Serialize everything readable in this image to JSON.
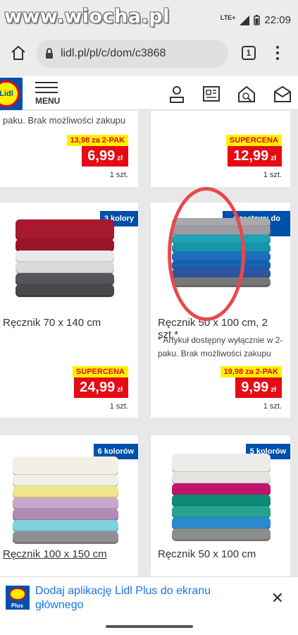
{
  "status": {
    "watermark": "www.wiocha.pl",
    "network": "LTE+",
    "time": "22:09"
  },
  "browser": {
    "url": "lidl.pl/pl/c/dom/c3868",
    "tab_count": "1"
  },
  "header": {
    "menu_label": "MENU"
  },
  "products": [
    {
      "note": "paku. Brak możliwości zakupu",
      "tag": "13,98 za 2-PAK",
      "price": "6,99",
      "currency": "zł",
      "qty": "1 szt."
    },
    {
      "tag": "SUPERCENA",
      "price": "12,99",
      "currency": "zł",
      "qty": "1 szt."
    },
    {
      "badge": "3 kolory",
      "title": "Ręcznik 70 x 140 cm",
      "tag": "SUPERCENA",
      "price": "24,99",
      "currency": "zł",
      "qty": "1 szt."
    },
    {
      "badge": "4 zestawy do wyboru",
      "title": "Ręcznik 50 x 100 cm, 2 szt.*",
      "note": "* Artykuł dostępny wyłącznie w 2-paku. Brak możliwości zakupu",
      "tag": "19,98 za 2-PAK",
      "price": "9,99",
      "currency": "zł",
      "qty": "1 szt."
    },
    {
      "badge": "6 kolorów",
      "title": "Ręcznik 100 x 150 cm"
    },
    {
      "badge": "5 kolorów",
      "title": "Ręcznik 50 x 100 cm"
    }
  ],
  "banner": {
    "text": "Dodaj aplikację Lidl Plus do ekranu głównego",
    "logo_label": "Plus"
  },
  "colors": {
    "lidl_blue": "#0050aa",
    "lidl_red": "#e60a14",
    "lidl_yellow": "#fff000",
    "link_blue": "#1a73e8"
  }
}
